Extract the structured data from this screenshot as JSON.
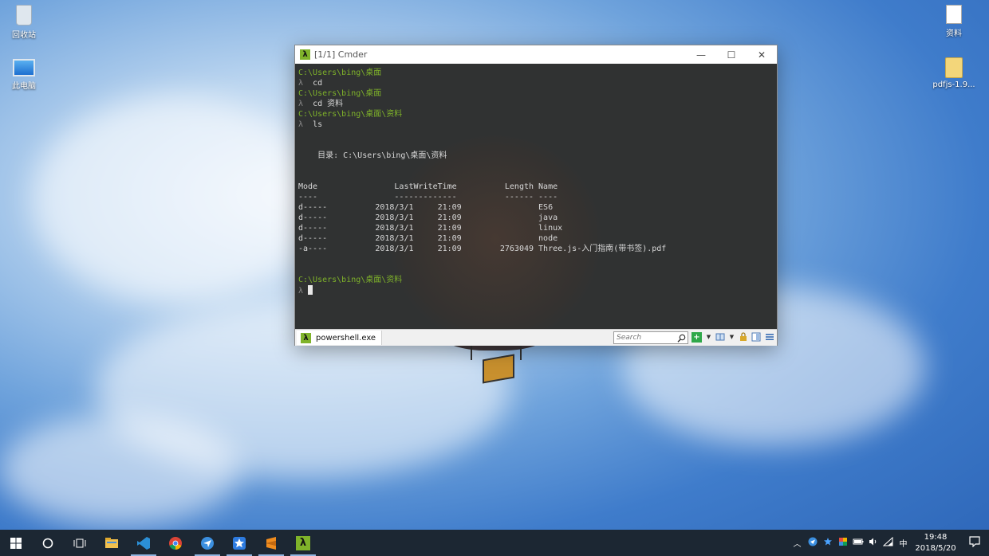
{
  "desktop": {
    "icons": [
      {
        "label": "回收站"
      },
      {
        "label": "此电脑"
      },
      {
        "label": "资料"
      },
      {
        "label": "pdfjs-1.9..."
      }
    ]
  },
  "window": {
    "title": "[1/1] Cmder",
    "buttons": {
      "minimize": "—",
      "maximize": "☐",
      "close": "✕"
    }
  },
  "terminal": {
    "prompt_prefix": "λ",
    "lines": [
      {
        "path": "C:\\Users\\bing\\桌面",
        "cmd": "cd"
      },
      {
        "path": "C:\\Users\\bing\\桌面",
        "cmd": "cd 资料"
      },
      {
        "path": "C:\\Users\\bing\\桌面\\资料",
        "cmd": "ls"
      }
    ],
    "directory_line": "    目录: C:\\Users\\bing\\桌面\\资料",
    "headers": {
      "mode": "Mode",
      "lastwrite": "LastWriteTime",
      "length": "Length",
      "name": "Name"
    },
    "underlines": {
      "mode": "----",
      "lastwrite": "-------------",
      "length": "------",
      "name": "----"
    },
    "rows": [
      {
        "mode": "d-----",
        "date": "2018/3/1",
        "time": "21:09",
        "length": "",
        "name": "ES6"
      },
      {
        "mode": "d-----",
        "date": "2018/3/1",
        "time": "21:09",
        "length": "",
        "name": "java"
      },
      {
        "mode": "d-----",
        "date": "2018/3/1",
        "time": "21:09",
        "length": "",
        "name": "linux"
      },
      {
        "mode": "d-----",
        "date": "2018/3/1",
        "time": "21:09",
        "length": "",
        "name": "node"
      },
      {
        "mode": "-a----",
        "date": "2018/3/1",
        "time": "21:09",
        "length": "2763049",
        "name": "Three.js-入门指南(带书签).pdf"
      }
    ],
    "final_path": "C:\\Users\\bing\\桌面\\资料"
  },
  "statusbar": {
    "tab_label": "powershell.exe",
    "search_placeholder": "Search"
  },
  "taskbar": {
    "apps": [
      "start",
      "cortana",
      "task-view",
      "file-explorer",
      "vscode",
      "chrome",
      "feishu",
      "app-star",
      "sublime-text",
      "cmder"
    ],
    "tray": {
      "ime": "中",
      "time": "19:48",
      "date": "2018/5/20"
    }
  }
}
